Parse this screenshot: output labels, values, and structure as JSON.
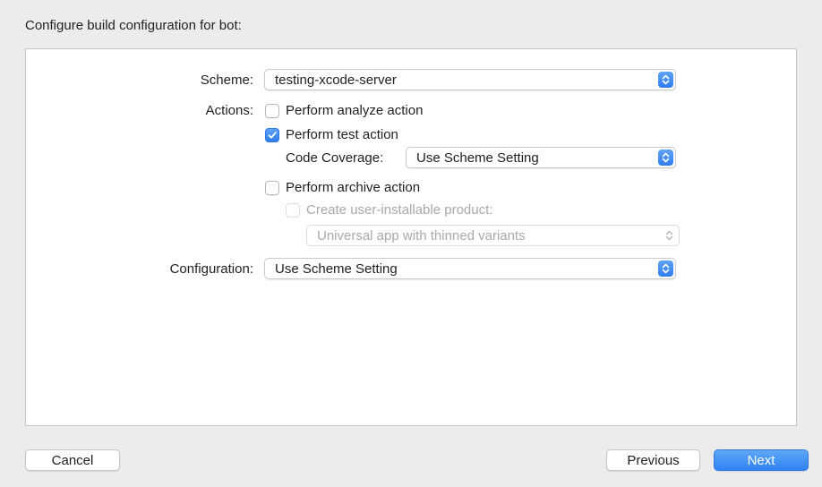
{
  "sheet": {
    "title": "Configure build configuration for bot:"
  },
  "form": {
    "scheme": {
      "label": "Scheme:",
      "value": "testing-xcode-server"
    },
    "actions": {
      "label": "Actions:",
      "analyze": {
        "label": "Perform analyze action",
        "checked": false
      },
      "test": {
        "label": "Perform test action",
        "checked": true
      },
      "code_coverage": {
        "label": "Code Coverage:",
        "value": "Use Scheme Setting"
      },
      "archive": {
        "label": "Perform archive action",
        "checked": false
      },
      "user_installable": {
        "label": "Create user-installable product:",
        "checked": false,
        "enabled": false
      },
      "product_type": {
        "value": "Universal app with thinned variants",
        "enabled": false
      }
    },
    "configuration": {
      "label": "Configuration:",
      "value": "Use Scheme Setting"
    }
  },
  "footer": {
    "cancel_label": "Cancel",
    "previous_label": "Previous",
    "next_label": "Next"
  },
  "colors": {
    "accent": "#2f82f2",
    "background": "#ececec",
    "panel": "#ffffff"
  }
}
